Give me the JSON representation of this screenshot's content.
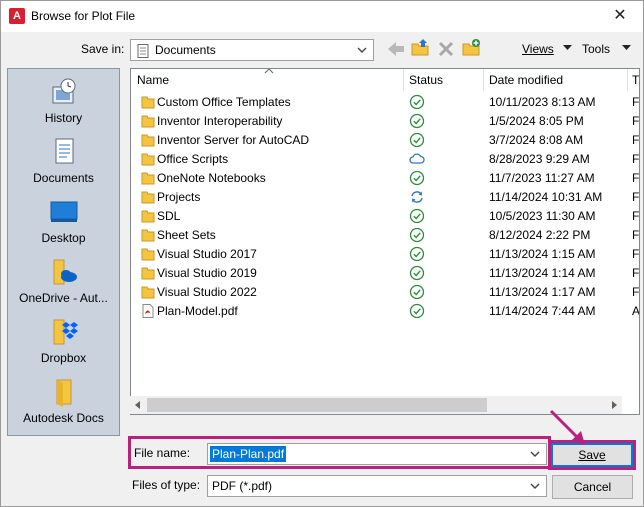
{
  "window": {
    "title": "Browse for Plot File",
    "app_icon_letter": "A",
    "close_glyph": "✕"
  },
  "toolbar": {
    "save_in_label": "Save in:",
    "save_in_value": "Documents",
    "views_label": "Views",
    "tools_label": "Tools",
    "icons": [
      "back-icon",
      "up-folder-icon",
      "delete-icon",
      "new-folder-icon"
    ]
  },
  "places": [
    {
      "label": "History",
      "icon": "history-icon"
    },
    {
      "label": "Documents",
      "icon": "documents-icon"
    },
    {
      "label": "Desktop",
      "icon": "desktop-icon"
    },
    {
      "label": "OneDrive - Aut...",
      "icon": "onedrive-icon"
    },
    {
      "label": "Dropbox",
      "icon": "dropbox-icon"
    },
    {
      "label": "Autodesk Docs",
      "icon": "folder-icon"
    }
  ],
  "columns": {
    "name": "Name",
    "status": "Status",
    "date": "Date modified",
    "extra": "T"
  },
  "files": [
    {
      "name": "Custom Office Templates",
      "type": "folder",
      "status": "synced",
      "date": "10/11/2023 8:13 AM",
      "extra": "F"
    },
    {
      "name": "Inventor Interoperability",
      "type": "folder",
      "status": "synced",
      "date": "1/5/2024 8:05 PM",
      "extra": "F"
    },
    {
      "name": "Inventor Server for AutoCAD",
      "type": "folder",
      "status": "synced",
      "date": "3/7/2024 8:08 AM",
      "extra": "F"
    },
    {
      "name": "Office Scripts",
      "type": "folder",
      "status": "cloud",
      "date": "8/28/2023 9:29 AM",
      "extra": "F"
    },
    {
      "name": "OneNote Notebooks",
      "type": "folder",
      "status": "synced",
      "date": "11/7/2023 11:27 AM",
      "extra": "F"
    },
    {
      "name": "Projects",
      "type": "folder",
      "status": "syncing",
      "date": "11/14/2024 10:31 AM",
      "extra": "F"
    },
    {
      "name": "SDL",
      "type": "folder",
      "status": "synced",
      "date": "10/5/2023 11:30 AM",
      "extra": "F"
    },
    {
      "name": "Sheet Sets",
      "type": "folder",
      "status": "synced",
      "date": "8/12/2024 2:22 PM",
      "extra": "F"
    },
    {
      "name": "Visual Studio 2017",
      "type": "folder",
      "status": "synced",
      "date": "11/13/2024 1:15 AM",
      "extra": "F"
    },
    {
      "name": "Visual Studio 2019",
      "type": "folder",
      "status": "synced",
      "date": "11/13/2024 1:14 AM",
      "extra": "F"
    },
    {
      "name": "Visual Studio 2022",
      "type": "folder",
      "status": "synced",
      "date": "11/13/2024 1:17 AM",
      "extra": "F"
    },
    {
      "name": "Plan-Model.pdf",
      "type": "pdf",
      "status": "synced",
      "date": "11/14/2024 7:44 AM",
      "extra": "A"
    }
  ],
  "file_name": {
    "label": "File name:",
    "value": "Plan-Plan.pdf"
  },
  "file_type": {
    "label": "Files of type:",
    "value": "PDF (*.pdf)"
  },
  "buttons": {
    "save": "Save",
    "cancel": "Cancel"
  },
  "colors": {
    "highlight": "#b8227c",
    "folder": "#f5c542",
    "synced": "#2e8b3e",
    "cloud": "#2b78c2",
    "selection": "#0078d7",
    "places_bg": "#c9d2dd"
  }
}
